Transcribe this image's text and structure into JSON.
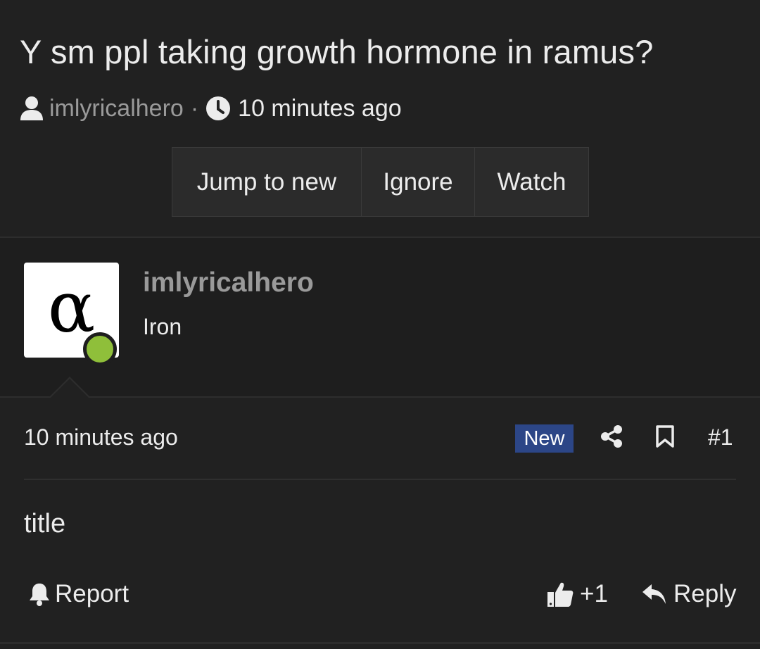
{
  "thread": {
    "title": "Y sm ppl taking growth hormone in ramus?",
    "author": "imlyricalhero",
    "separator": "·",
    "time": "10 minutes ago"
  },
  "actions": {
    "jump_to_new": "Jump to new",
    "ignore": "Ignore",
    "watch": "Watch"
  },
  "post": {
    "avatar_letter": "α",
    "username": "imlyricalhero",
    "user_title": "Iron",
    "time": "10 minutes ago",
    "badge": "New",
    "number": "#1",
    "body": "title",
    "report_label": "Report",
    "reaction_count": "+1",
    "reply_label": "Reply"
  },
  "colors": {
    "background": "#212121",
    "user_block": "#1e1e1e",
    "badge_new": "#2c4687",
    "online_dot": "#8fbf3a",
    "muted_text": "#9a9a9a"
  },
  "icons": [
    "user-icon",
    "clock-icon",
    "share-icon",
    "bookmark-icon",
    "bell-icon",
    "thumbs-up-icon",
    "reply-icon"
  ]
}
